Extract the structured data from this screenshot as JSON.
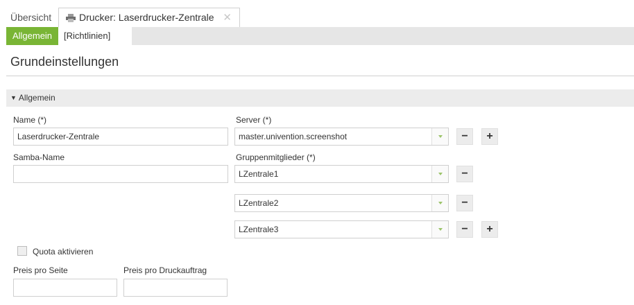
{
  "tabs": {
    "overview": "Übersicht",
    "printer": "Drucker: Laserdrucker-Zentrale"
  },
  "subtabs": {
    "general": "Allgemein",
    "policies": "[Richtlinien]"
  },
  "page_title": "Grundeinstellungen",
  "section_title": "Allgemein",
  "form": {
    "name_label": "Name (*)",
    "name_value": "Laserdrucker-Zentrale",
    "samba_label": "Samba-Name",
    "samba_value": "",
    "server_label": "Server (*)",
    "server_value": "master.univention.screenshot",
    "members_label": "Gruppenmitglieder (*)",
    "members": [
      "LZentrale1",
      "LZentrale2",
      "LZentrale3"
    ],
    "quota_label": "Quota aktivieren",
    "price_page_label": "Preis pro Seite",
    "price_page_value": "",
    "price_job_label": "Preis pro Druckauftrag",
    "price_job_value": ""
  },
  "colors": {
    "accent": "#79b535",
    "arrow": "#9cc46a"
  },
  "icons": {
    "printer": "printer-icon",
    "close": "close-icon",
    "caret": "caret-down-icon",
    "dropdown": "chevron-down-icon",
    "remove": "minus-icon",
    "add": "plus-icon"
  }
}
